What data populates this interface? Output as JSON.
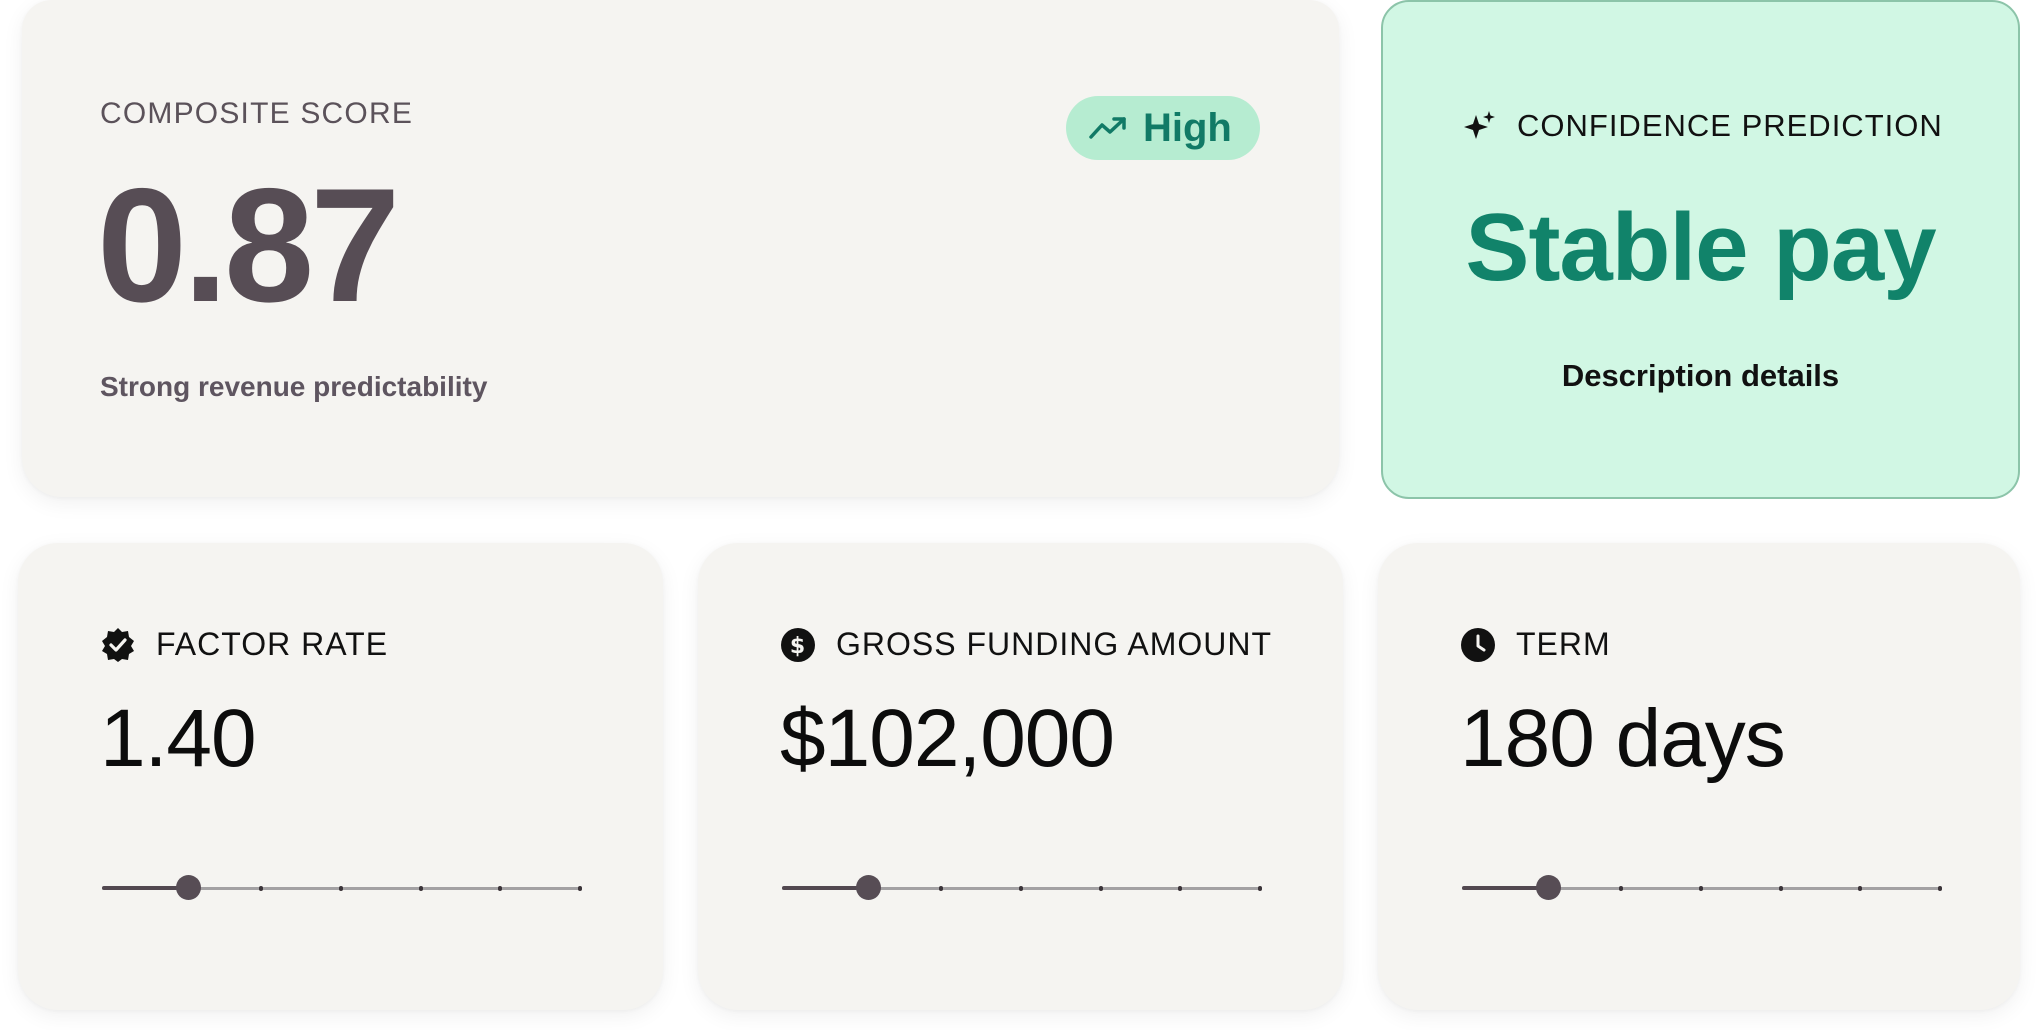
{
  "composite": {
    "label": "COMPOSITE SCORE",
    "score": "0.87",
    "subtitle": "Strong revenue predictability",
    "badge": {
      "label": "High",
      "icon": "trending-up-icon"
    }
  },
  "confidence": {
    "label": "CONFIDENCE PREDICTION",
    "icon": "sparkles-icon",
    "prediction": "Stable pay",
    "description": "Description details"
  },
  "metrics": [
    {
      "label": "FACTOR RATE",
      "icon": "verified-badge-icon",
      "value": "1.40",
      "slider": {
        "level": 0.18,
        "steps": 6
      }
    },
    {
      "label": "GROSS FUNDING AMOUNT",
      "icon": "dollar-circle-icon",
      "value": "$102,000",
      "slider": {
        "level": 0.18,
        "steps": 6
      }
    },
    {
      "label": "TERM",
      "icon": "clock-icon",
      "value": "180 days",
      "slider": {
        "level": 0.18,
        "steps": 6
      }
    }
  ],
  "colors": {
    "accent": "#11836a",
    "badge_bg": "#b6ecd1",
    "confidence_bg": "#d1f7e4",
    "card_bg": "#f5f4f1",
    "score_text": "#574d55"
  }
}
